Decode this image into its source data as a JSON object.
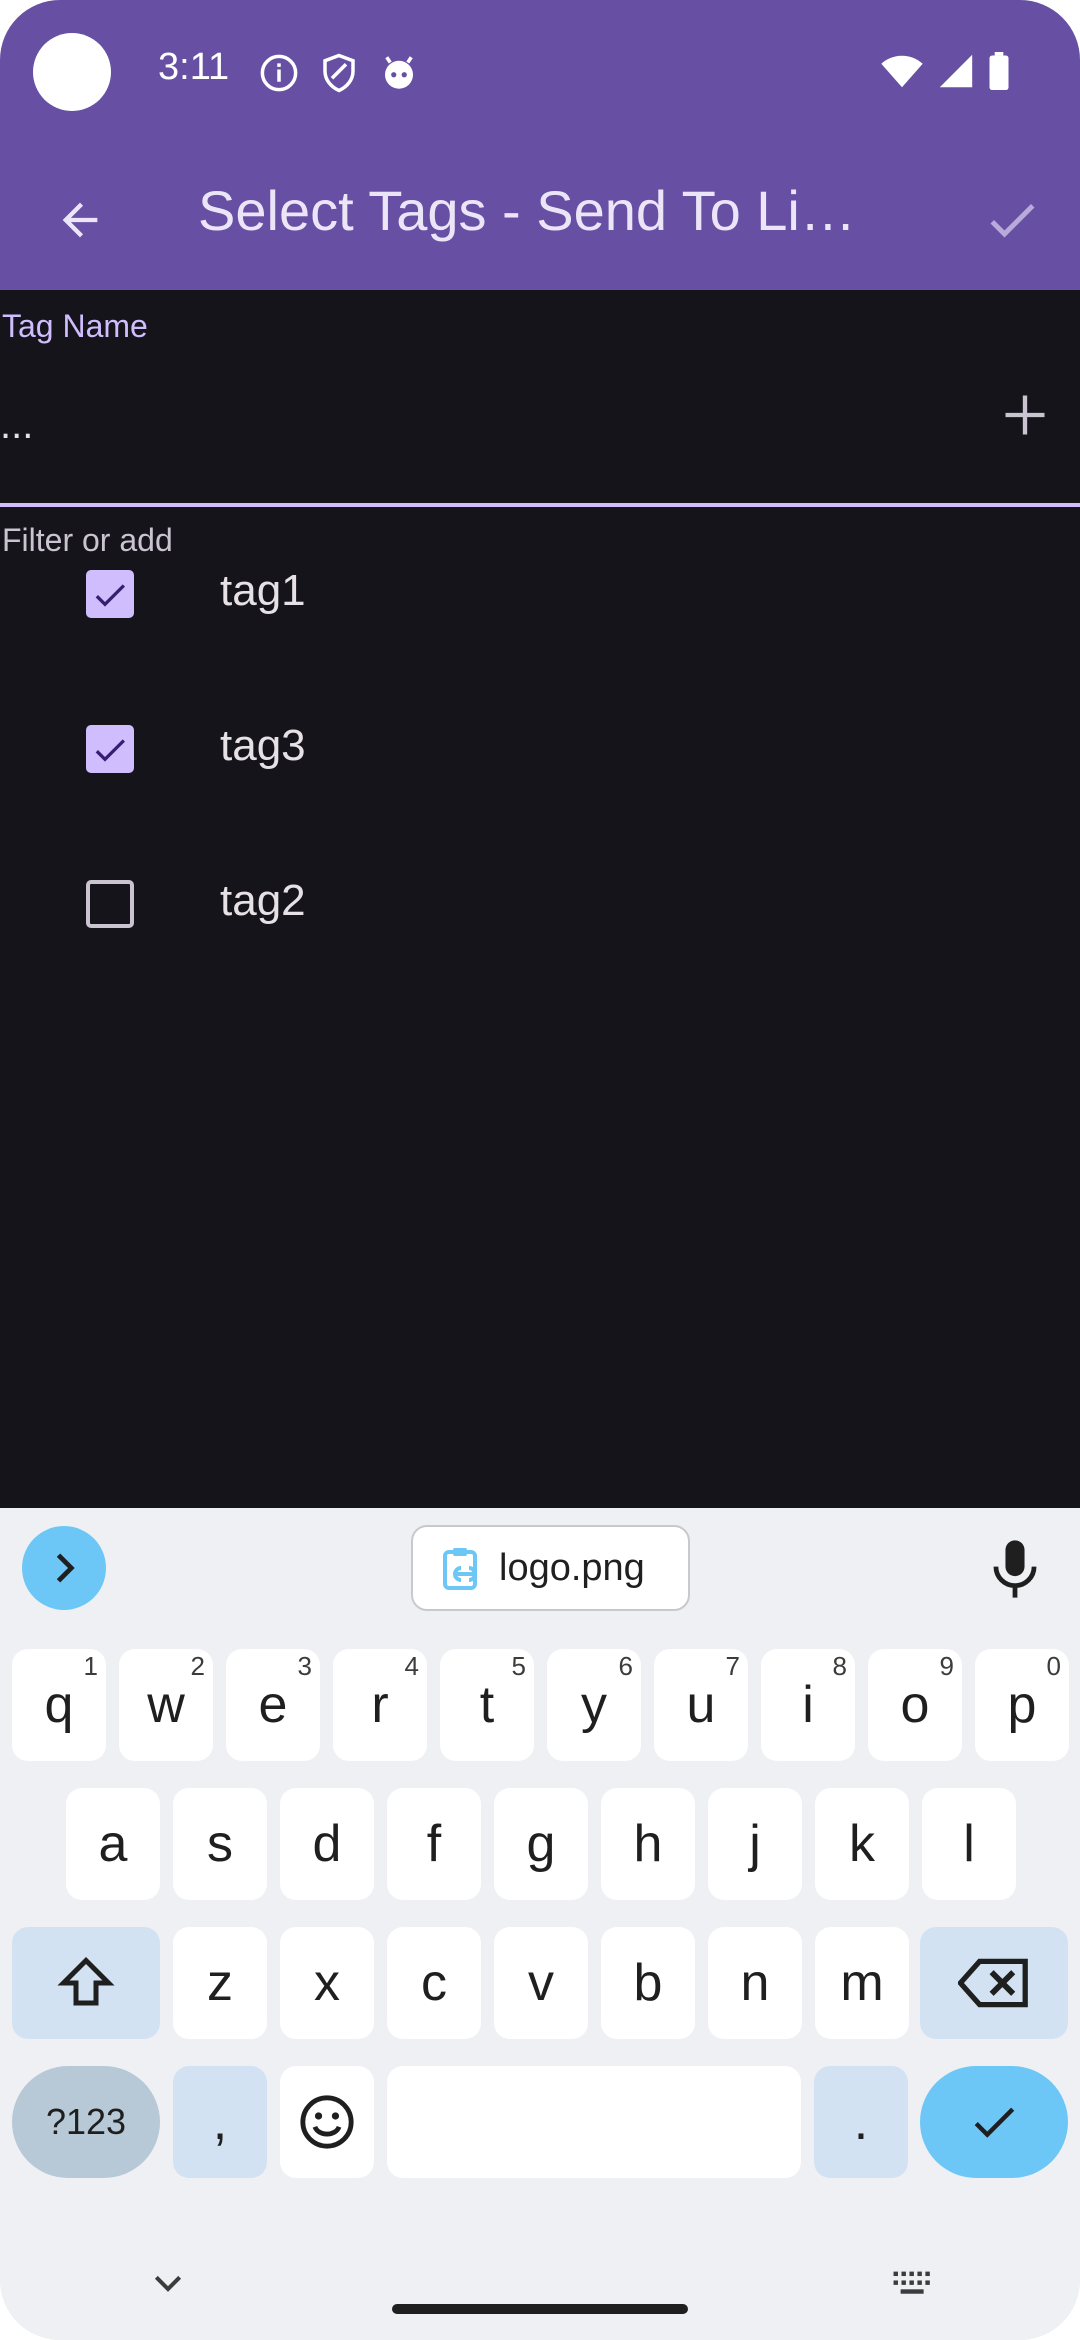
{
  "status_bar": {
    "time": "3:11",
    "left_icons": [
      "info-icon",
      "shield-icon",
      "robot-face-icon"
    ],
    "right_icons": [
      "wifi-icon",
      "signal-icon",
      "battery-icon"
    ]
  },
  "toolbar": {
    "title": "Select Tags - Send To Li…",
    "back_icon": "arrow-back-icon",
    "done_icon": "check-icon"
  },
  "tag_field": {
    "label": "Tag Name",
    "value": "",
    "placeholder": "...",
    "helper": "Filter or add",
    "add_icon": "plus-icon"
  },
  "tags": [
    {
      "name": "tag1",
      "checked": true
    },
    {
      "name": "tag3",
      "checked": true
    },
    {
      "name": "tag2",
      "checked": false
    }
  ],
  "keyboard": {
    "clipboard_chip": "logo.png",
    "row1": [
      {
        "l": "q",
        "n": "1"
      },
      {
        "l": "w",
        "n": "2"
      },
      {
        "l": "e",
        "n": "3"
      },
      {
        "l": "r",
        "n": "4"
      },
      {
        "l": "t",
        "n": "5"
      },
      {
        "l": "y",
        "n": "6"
      },
      {
        "l": "u",
        "n": "7"
      },
      {
        "l": "i",
        "n": "8"
      },
      {
        "l": "o",
        "n": "9"
      },
      {
        "l": "p",
        "n": "0"
      }
    ],
    "row2": [
      "a",
      "s",
      "d",
      "f",
      "g",
      "h",
      "j",
      "k",
      "l"
    ],
    "row3": [
      "z",
      "x",
      "c",
      "v",
      "b",
      "n",
      "m"
    ],
    "sym_key": "?123",
    "comma_key": ",",
    "period_key": ".",
    "icons": {
      "expand": "chevron-right-icon",
      "mic": "mic-icon",
      "shift": "shift-icon",
      "backspace": "backspace-icon",
      "emoji": "emoji-icon",
      "enter": "check-icon",
      "hide": "chevron-down-icon",
      "switch": "keyboard-icon"
    }
  },
  "colors": {
    "app_bar": "#6750a4",
    "background": "#16141b",
    "accent": "#cfbdfe",
    "keyboard_bg": "#eff0f4",
    "key_accent": "#6cc7f7"
  }
}
